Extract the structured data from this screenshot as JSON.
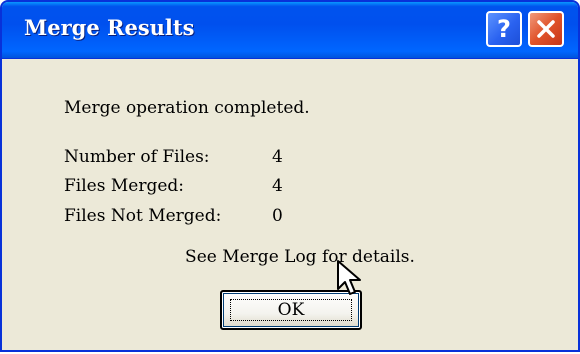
{
  "dialog": {
    "title": "Merge Results",
    "help_label": "?",
    "message": "Merge operation completed.",
    "stats": [
      {
        "label": "Number of Files:",
        "value": "4"
      },
      {
        "label": "Files Merged:",
        "value": "4"
      },
      {
        "label": "Files Not Merged:",
        "value": "0"
      }
    ],
    "details": "See Merge Log for details.",
    "ok_label": "OK"
  },
  "icons": {
    "help": "question-mark-icon",
    "close": "close-x-icon",
    "cursor": "mouse-pointer-icon"
  },
  "colors": {
    "titlebar": "#0053ee",
    "dialog_bg": "#ece9d8",
    "close_button": "#e0532a",
    "help_button": "#2a62f0"
  }
}
